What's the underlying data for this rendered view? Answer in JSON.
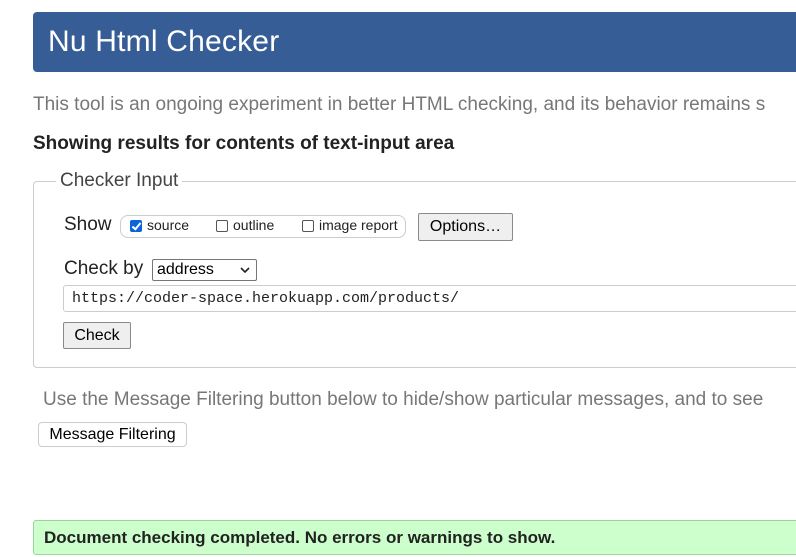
{
  "header": {
    "title": "Nu Html Checker"
  },
  "intro_text": "This tool is an ongoing experiment in better HTML checking, and its behavior remains s",
  "results_heading": "Showing results for contents of text-input area",
  "checker_input": {
    "legend": "Checker Input",
    "show_label": "Show",
    "options": [
      {
        "label": "source",
        "checked": true
      },
      {
        "label": "outline",
        "checked": false
      },
      {
        "label": "image report",
        "checked": false
      }
    ],
    "options_button": "Options…",
    "check_by_label": "Check by",
    "check_by_value": "address",
    "url_value": "https://coder-space.herokuapp.com/products/",
    "check_button": "Check"
  },
  "filter_note": "Use the Message Filtering button below to hide/show particular messages, and to see",
  "filter_button": "Message Filtering",
  "status": {
    "message": "Document checking completed. No errors or warnings to show."
  },
  "colors": {
    "banner": "#365d95",
    "success_bg": "#ccffcc",
    "checkbox_accent": "#0b65d8"
  }
}
